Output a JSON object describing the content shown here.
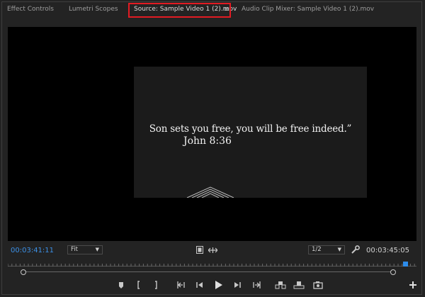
{
  "tabs": {
    "effect_controls": "Effect Controls",
    "lumetri_scopes": "Lumetri Scopes",
    "source": "Source: Sample Video 1 (2).mov",
    "audio_mixer": "Audio Clip Mixer: Sample Video 1 (2).mov",
    "menu_glyph": "≡"
  },
  "video": {
    "caption_line1": "Son sets you free, you will be free indeed.”",
    "caption_line2": "John 8:36"
  },
  "controls": {
    "current_timecode": "00:03:41:11",
    "zoom_value": "Fit",
    "resolution_value": "1/2",
    "duration_timecode": "00:03:45:05"
  },
  "colors": {
    "accent_blue": "#2d8ceb",
    "highlight_red": "#e21b23",
    "panel_bg": "#232323"
  },
  "icons": {
    "settings": "wrench-icon",
    "safe_margins": "film-strip-icon",
    "insert": "insert-icon",
    "add_button": "plus-icon"
  }
}
